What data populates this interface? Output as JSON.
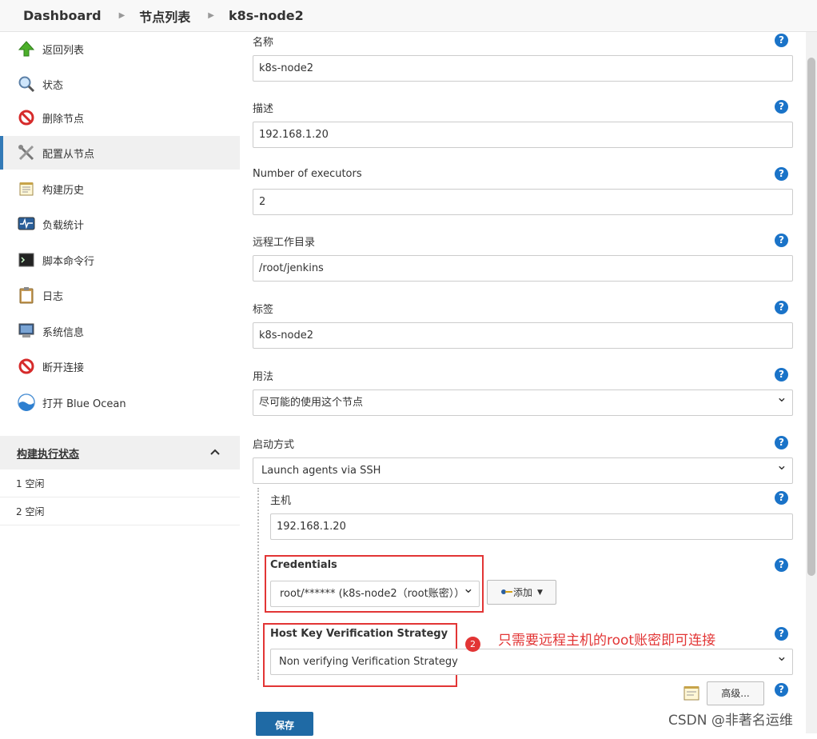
{
  "breadcrumb": [
    "Dashboard",
    "节点列表",
    "k8s-node2"
  ],
  "sidebar": {
    "items": [
      {
        "label": "返回列表",
        "icon": "arrow-up-icon"
      },
      {
        "label": "状态",
        "icon": "magnifier-icon"
      },
      {
        "label": "删除节点",
        "icon": "no-entry-icon"
      },
      {
        "label": "配置从节点",
        "icon": "wrench-screwdriver-icon",
        "active": true
      },
      {
        "label": "构建历史",
        "icon": "notepad-icon"
      },
      {
        "label": "负载统计",
        "icon": "monitor-graph-icon"
      },
      {
        "label": "脚本命令行",
        "icon": "terminal-icon"
      },
      {
        "label": "日志",
        "icon": "clipboard-icon"
      },
      {
        "label": "系统信息",
        "icon": "computer-icon"
      },
      {
        "label": "断开连接",
        "icon": "no-entry-icon"
      },
      {
        "label": "打开 Blue Ocean",
        "icon": "blue-ocean-icon"
      }
    ],
    "executor": {
      "title": "构建执行状态",
      "rows": [
        "1  空闲",
        "2  空闲"
      ]
    }
  },
  "form": {
    "name": {
      "label": "名称",
      "value": "k8s-node2"
    },
    "description": {
      "label": "描述",
      "value": "192.168.1.20"
    },
    "executors": {
      "label": "Number of executors",
      "value": "2"
    },
    "remote_dir": {
      "label": "远程工作目录",
      "value": "/root/jenkins"
    },
    "labels": {
      "label": "标签",
      "value": "k8s-node2"
    },
    "usage": {
      "label": "用法",
      "value": "尽可能的使用这个节点"
    },
    "launch": {
      "label": "启动方式",
      "value": "Launch agents via SSH"
    },
    "host": {
      "label": "主机",
      "value": "192.168.1.20"
    },
    "credentials": {
      "label": "Credentials",
      "value": "root/****** (k8s-node2（root账密））"
    },
    "add_button": "添加",
    "host_key": {
      "label": "Host Key Verification Strategy",
      "value": "Non verifying Verification Strategy"
    },
    "advanced_button": "高级...",
    "save_button": "保存",
    "help_glyph": "?"
  },
  "annotation": {
    "badge": "2",
    "text": "只需要远程主机的root账密即可连接"
  },
  "watermark": "CSDN @非著名运维",
  "colors": {
    "accent": "#1a73c8",
    "annotation": "#e23535",
    "save": "#1f6aa5"
  }
}
